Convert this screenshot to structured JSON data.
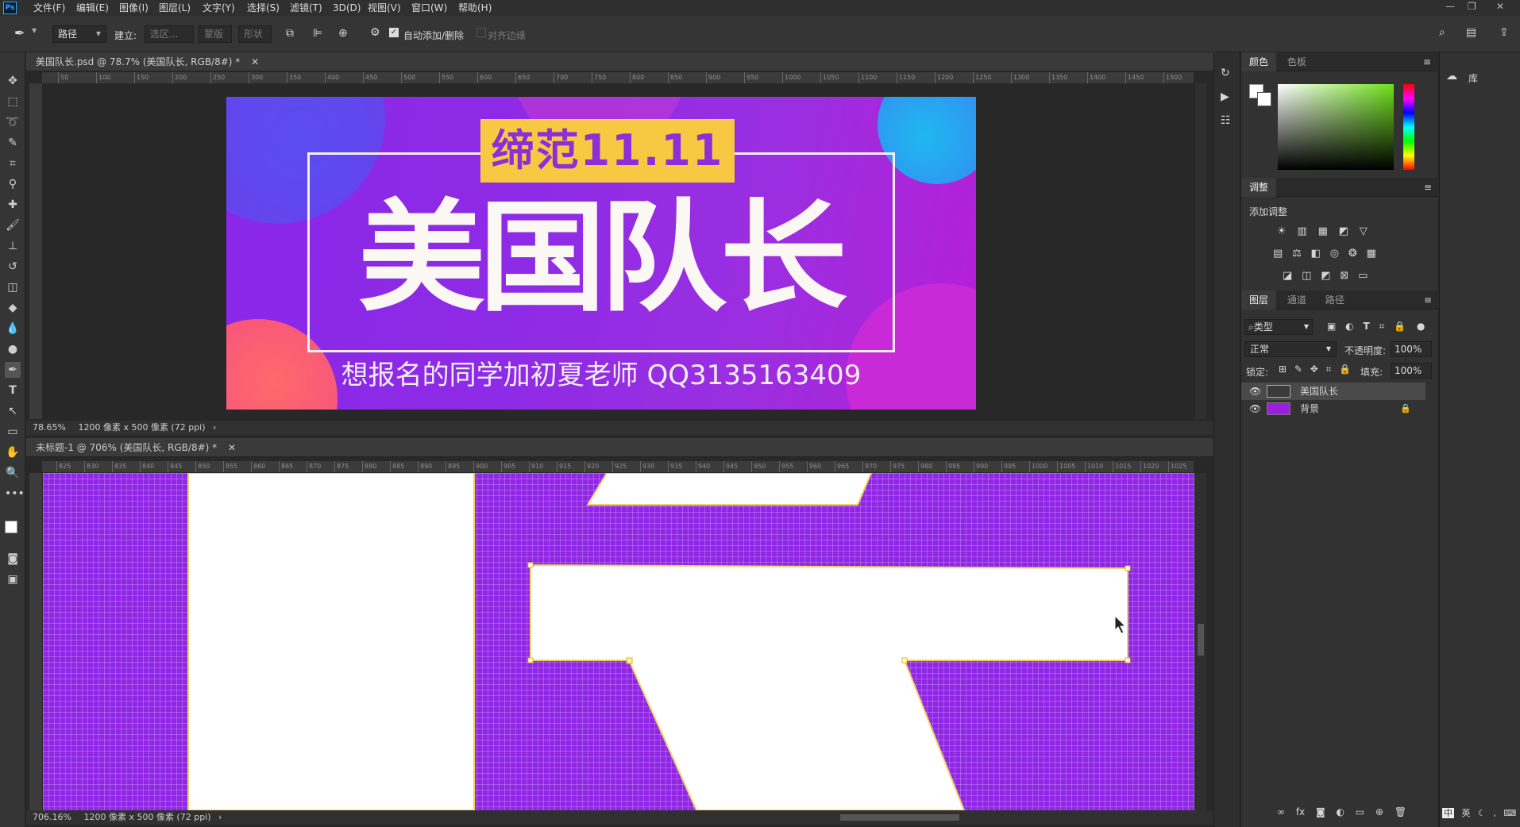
{
  "app": {
    "logo": "Ps"
  },
  "menu": [
    "文件(F)",
    "编辑(E)",
    "图像(I)",
    "图层(L)",
    "文字(Y)",
    "选择(S)",
    "滤镜(T)",
    "3D(D)",
    "视图(V)",
    "窗口(W)",
    "帮助(H)"
  ],
  "options": {
    "mode": "路径",
    "build_label": "建立:",
    "selection": "选区...",
    "mask": "蒙版",
    "shape": "形状",
    "auto_add_delete": "自动添加/删除",
    "align_edges": "对齐边缘"
  },
  "doc1": {
    "tab": "美国队长.psd @ 78.7% (美国队长, RGB/8#) *",
    "zoom": "78.65%",
    "size": "1200 像素 x 500 像素 (72 ppi)",
    "ruler_ticks": [
      "50",
      "100",
      "150",
      "200",
      "250",
      "300",
      "350",
      "400",
      "450",
      "500",
      "550",
      "600",
      "650",
      "700",
      "750",
      "800",
      "850",
      "900",
      "950",
      "1000",
      "1050",
      "1100",
      "1150",
      "1200",
      "1250",
      "1300",
      "1350",
      "1400",
      "1450",
      "1500"
    ]
  },
  "banner": {
    "badge": "缔范11.11",
    "title": "美国队长",
    "subtitle": "想报名的同学加初夏老师 QQ3135163409"
  },
  "doc2": {
    "tab": "未标题-1 @ 706% (美国队长, RGB/8#) *",
    "zoom": "706.16%",
    "size": "1200 像素 x 500 像素 (72 ppi)",
    "ruler_ticks": [
      "825",
      "830",
      "835",
      "840",
      "845",
      "850",
      "855",
      "860",
      "865",
      "870",
      "875",
      "880",
      "885",
      "890",
      "895",
      "900",
      "905",
      "910",
      "915",
      "920",
      "925",
      "930",
      "935",
      "940",
      "945",
      "950",
      "955",
      "960",
      "965",
      "970",
      "975",
      "980",
      "985",
      "990",
      "995",
      "1000",
      "1005",
      "1010",
      "1015",
      "1020",
      "1025"
    ]
  },
  "panels": {
    "color_tabs": [
      "颜色",
      "色板"
    ],
    "adjust_tab": "调整",
    "adjust_label": "添加调整",
    "layer_tabs": [
      "图层",
      "通道",
      "路径"
    ],
    "filter_kind": "类型",
    "blend_mode": "正常",
    "opacity_label": "不透明度:",
    "opacity": "100%",
    "lock_label": "锁定:",
    "fill_label": "填充:",
    "fill": "100%",
    "layers": [
      {
        "name": "美国队长"
      },
      {
        "name": "背景"
      }
    ],
    "library": "库"
  },
  "taskbar": {
    "ime": "英"
  },
  "colors": {
    "banner_purple": "#8a27e8",
    "badge_yellow": "#f7c942",
    "layer_bg": "#9c1fe0"
  }
}
